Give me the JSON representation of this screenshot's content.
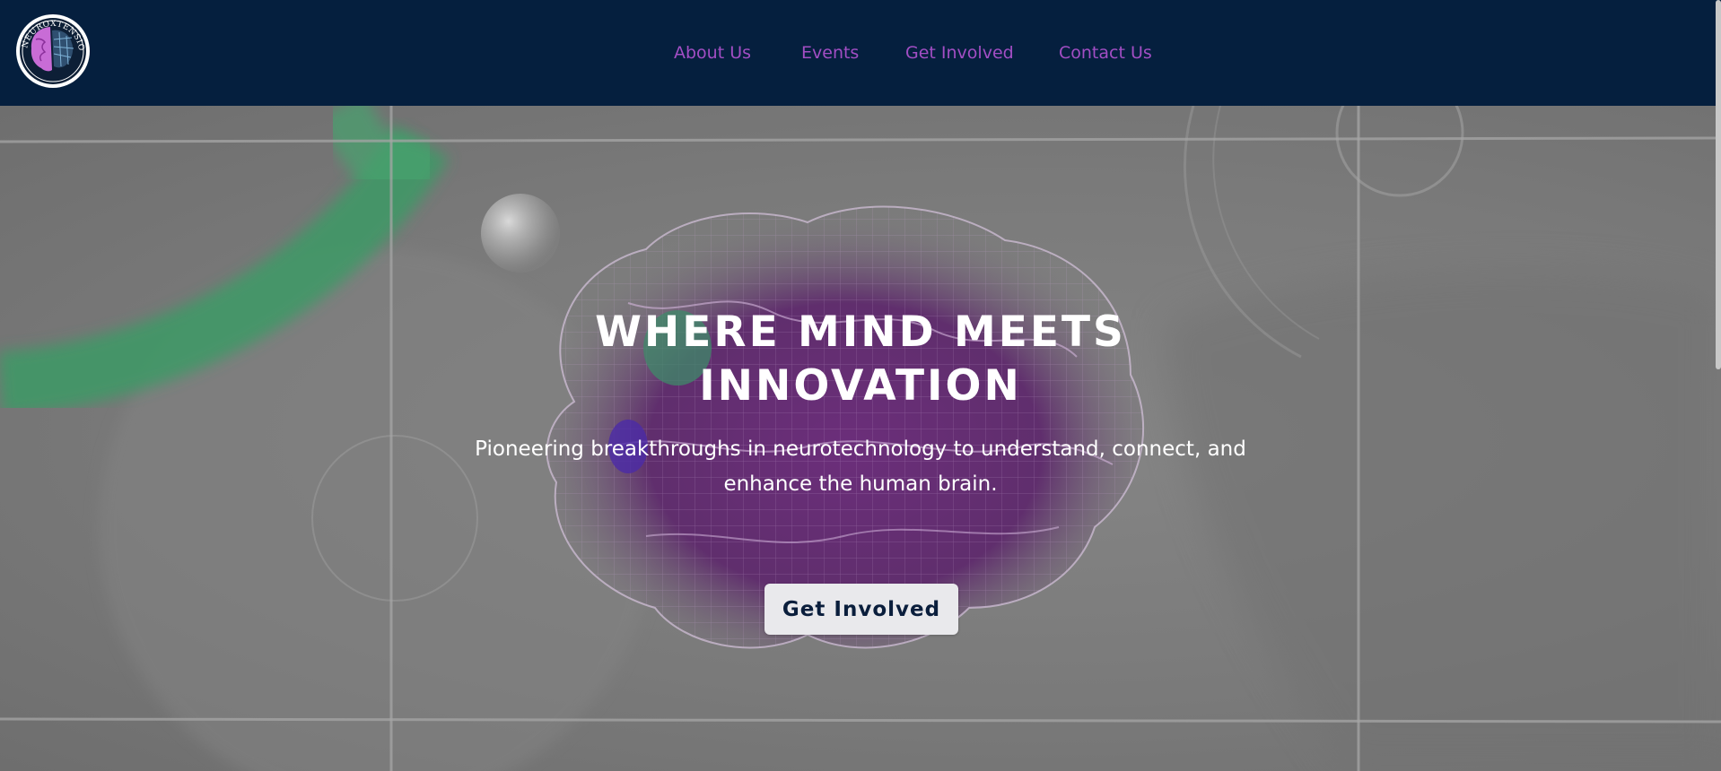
{
  "header": {
    "logo_text": "NEUROXTENSION",
    "nav": [
      {
        "label": "About Us"
      },
      {
        "label": "Events"
      },
      {
        "label": "Get Involved"
      },
      {
        "label": "Contact Us"
      }
    ]
  },
  "hero": {
    "title_line1": "WHERE MIND MEETS",
    "title_line2": "INNOVATION",
    "subtitle": "Pioneering breakthroughs in neurotechnology to understand, connect, and enhance the human brain.",
    "cta_label": "Get Involved",
    "background_image": "brain-wireframe"
  },
  "colors": {
    "header_bg": "#051f3e",
    "nav_link": "#a24ec4",
    "cta_bg": "#e9e9ec",
    "cta_text": "#0a1e3c",
    "brain_accent": "#7a2f8a"
  }
}
